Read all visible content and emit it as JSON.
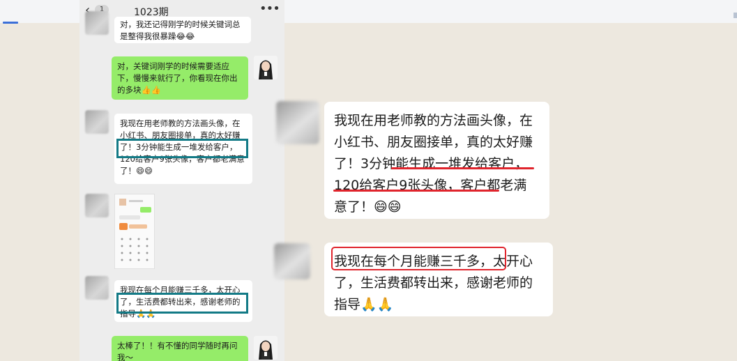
{
  "phone": {
    "title": "1023期",
    "unread_badge": "1",
    "back_icon": "‹",
    "more_icon": "•••",
    "messages": [
      {
        "text": "对，我还记得刚学的时候关键词总是整得我很暴躁😂😂"
      },
      {
        "text": "对，关键词刚学的时候需要适应下，慢慢来就行了，你看现在你出的多块👍👍"
      },
      {
        "text": "我现在用老师教的方法画头像，在小红书、朋友圈接单，真的太好赚了！3分钟能生成一堆发给客户，120给客户9张头像，客户都老满意了！😄😄"
      },
      {
        "text": "我现在每个月能赚三千多，太开心了，生活费都转出来，感谢老师的指导🙏🙏"
      },
      {
        "text": "太棒了！！有不懂的同学随时再问我～"
      }
    ]
  },
  "zoom": {
    "quote1": "我现在用老师教的方法画头像，在小红书、朋友圈接单，真的太好赚了！3分钟能生成一堆发给客户，120给客户9张头像，客户都老满意了！😄😄",
    "quote2": "我现在每个月能赚三千多，太开心了，生活费都转出来，感谢老师的指导🙏🙏"
  },
  "colors": {
    "highlight_teal": "#137a86",
    "highlight_red": "#e0242c",
    "bubble_green": "#95ec69"
  }
}
